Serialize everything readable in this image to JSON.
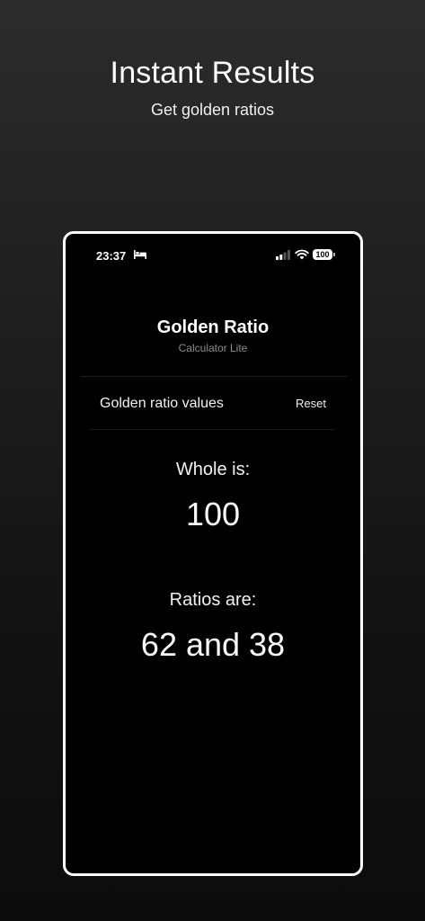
{
  "promo": {
    "headline": "Instant Results",
    "subline": "Get golden ratios"
  },
  "status_bar": {
    "time": "23:37",
    "battery": "100",
    "icons": [
      "bed-icon",
      "cellular-signal-icon",
      "wifi-icon",
      "battery-icon"
    ]
  },
  "app": {
    "title": "Golden Ratio",
    "subtitle": "Calculator Lite"
  },
  "section": {
    "label": "Golden ratio values",
    "reset_label": "Reset"
  },
  "results": {
    "whole_label": "Whole is:",
    "whole_value": "100",
    "ratios_label": "Ratios are:",
    "ratios_value": "62 and 38"
  },
  "colors": {
    "background_top": "#2c2c2c",
    "background_bottom": "#0c0c0c",
    "phone_border": "#ffffff",
    "screen": "#000000",
    "muted_text": "#8e8e8e"
  }
}
